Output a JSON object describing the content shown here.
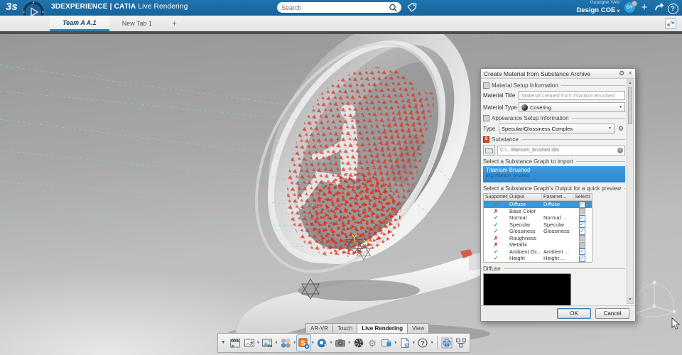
{
  "header": {
    "logo": "3s",
    "brand_bold": "3DEXPERIENCE",
    "brand_sep": "|",
    "brand_app": "CATIA",
    "brand_context": "Live Rendering",
    "search_placeholder": "Search",
    "user_name": "Guanghe YAN",
    "user_role": "Design COE",
    "role_caret": "▾",
    "avatar_initials": "GY",
    "plus_label": "+"
  },
  "tabbar": {
    "tabs": [
      {
        "label": "Team A A.1",
        "active": true
      },
      {
        "label": "New Tab 1",
        "active": false
      }
    ],
    "new_tab_label": "+"
  },
  "dialog": {
    "title": "Create Material from Substance Archive",
    "gear_icon": "⚙",
    "close_icon": "×",
    "sections": {
      "material_setup": "Material Setup Information",
      "appearance_setup": "Appearance Setup Information",
      "substance": "Substance",
      "substance_icon_letter": "S",
      "graph_import": "Select a Substance Graph to import",
      "graph_output": "Select a Substance Graph's Output for a quick preview",
      "preview": "Diffuse"
    },
    "fields": {
      "material_title_label": "Material Title",
      "material_title_placeholder": "Material created from Titanium Brushed",
      "material_type_label": "Material Type",
      "material_type_value": "Covering",
      "type_label": "Type",
      "type_value": "Specular/Glossiness Complex",
      "substance_path": "C:\\...\\titanium_brushed.sbs"
    },
    "graph_item": {
      "title": "Titanium Brushed",
      "subtitle": "pkg://titanium_brushed"
    },
    "table": {
      "headers": [
        "Supported",
        "Output",
        "Paramet...",
        "Selection"
      ],
      "rows": [
        {
          "supported": true,
          "output": "Diffuse",
          "param": "Diffuse",
          "checked": true,
          "enabled": true,
          "selected": true
        },
        {
          "supported": false,
          "output": "Base Color",
          "param": "",
          "checked": false,
          "enabled": false
        },
        {
          "supported": true,
          "output": "Normal",
          "param": "Normal ...",
          "checked": true,
          "enabled": true
        },
        {
          "supported": true,
          "output": "Specular",
          "param": "Specular",
          "checked": true,
          "enabled": true
        },
        {
          "supported": true,
          "output": "Glossiness",
          "param": "Glossiness",
          "checked": true,
          "enabled": true
        },
        {
          "supported": false,
          "output": "Roughness",
          "param": "",
          "checked": false,
          "enabled": false
        },
        {
          "supported": false,
          "output": "Metallic",
          "param": "",
          "checked": false,
          "enabled": false
        },
        {
          "supported": true,
          "output": "Ambient Oc...",
          "param": "Ambient ...",
          "checked": true,
          "enabled": true
        },
        {
          "supported": true,
          "output": "Height",
          "param": "Height ...",
          "checked": true,
          "enabled": true
        }
      ]
    },
    "buttons": {
      "ok": "OK",
      "cancel": "Cancel"
    }
  },
  "bottom": {
    "mode_tabs": [
      {
        "label": "AR-VR",
        "active": false
      },
      {
        "label": "Touch",
        "active": false
      },
      {
        "label": "Live Rendering",
        "active": true
      },
      {
        "label": "View",
        "active": false
      }
    ],
    "toolbar_icons": [
      "render-clapperboard-icon",
      "render-frame-icon",
      "environment-icon",
      "materials-spheres-icon",
      "substance-icon",
      "turntable-icon",
      "camera-icon",
      "aperture-icon",
      "settings-gear-icon",
      "render-output-icon",
      "process-settings-icon",
      "help-icon",
      "textured-sphere-icon",
      "connections-icon"
    ]
  },
  "colors": {
    "header_blue": "#1b6ca7",
    "tab_underline": "#2e7fb4",
    "selection_blue": "#3d96d6",
    "check_green": "#2f9e2f",
    "cross_red": "#cf2a1b",
    "arrow_red": "#e5321e",
    "substance_orange": "#e87722"
  }
}
